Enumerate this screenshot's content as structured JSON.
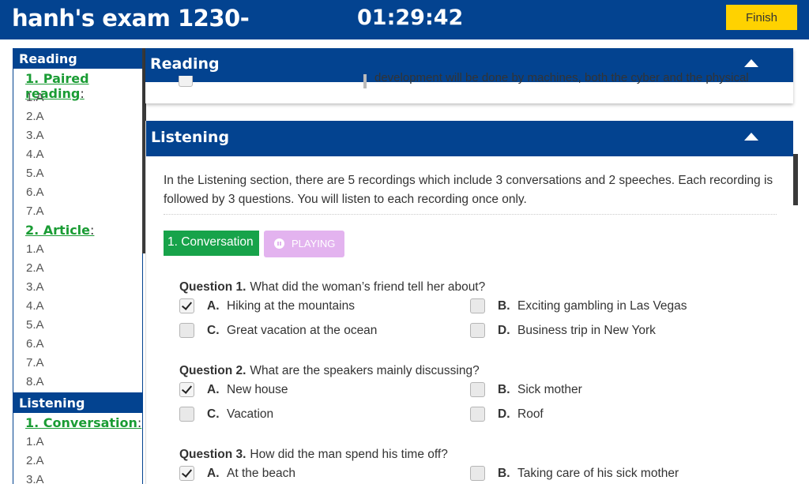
{
  "header": {
    "exam_title": "hanh's exam 1230-",
    "timer": "01:29:42",
    "finish_label": "Finish"
  },
  "sidebar": {
    "reading_title": "Reading",
    "reading_groups": [
      {
        "label": "1. Paired reading",
        "items": [
          "1.A",
          "2.A",
          "3.A",
          "4.A",
          "5.A",
          "6.A",
          "7.A"
        ]
      },
      {
        "label": "2. Article",
        "items": [
          "1.A",
          "2.A",
          "3.A",
          "4.A",
          "5.A",
          "6.A",
          "7.A",
          "8.A"
        ]
      }
    ],
    "listening_title": "Listening",
    "listening_groups": [
      {
        "label": "1. Conversation",
        "items": [
          "1.A",
          "2.A",
          "3.A"
        ]
      }
    ],
    "colon": ":"
  },
  "reading_panel": {
    "title": "Reading",
    "peek_text": "development will be done by machines, both the cyber and the physical"
  },
  "listening_panel": {
    "title": "Listening",
    "intro": "In the Listening section, there are 5 recordings which include 3 conversations and 2 speeches. Each recording is followed by 3 questions. You will listen to each recording once only.",
    "conversation_label": "1. Conversation",
    "playing_label": "PLAYING",
    "questions": [
      {
        "number": "Question 1.",
        "text": "What did the woman’s friend tell her about?",
        "options": [
          {
            "letter": "A.",
            "text": "Hiking at the mountains",
            "checked": true
          },
          {
            "letter": "B.",
            "text": "Exciting gambling in Las Vegas",
            "checked": false
          },
          {
            "letter": "C.",
            "text": "Great vacation at the ocean",
            "checked": false
          },
          {
            "letter": "D.",
            "text": "Business trip in New York",
            "checked": false
          }
        ]
      },
      {
        "number": "Question 2.",
        "text": "What are the speakers mainly discussing?",
        "options": [
          {
            "letter": "A.",
            "text": "New house",
            "checked": true
          },
          {
            "letter": "B.",
            "text": "Sick mother",
            "checked": false
          },
          {
            "letter": "C.",
            "text": "Vacation",
            "checked": false
          },
          {
            "letter": "D.",
            "text": "Roof",
            "checked": false
          }
        ]
      },
      {
        "number": "Question 3.",
        "text": "How did the man spend his time off?",
        "options": [
          {
            "letter": "A.",
            "text": "At the beach",
            "checked": true
          },
          {
            "letter": "B.",
            "text": "Taking care of his sick mother",
            "checked": false
          }
        ]
      }
    ]
  },
  "colors": {
    "primary": "#034390",
    "finish": "#ffd200",
    "conversation": "#17a34a",
    "playing": "#e3b3ef",
    "link": "#1a9c34"
  }
}
